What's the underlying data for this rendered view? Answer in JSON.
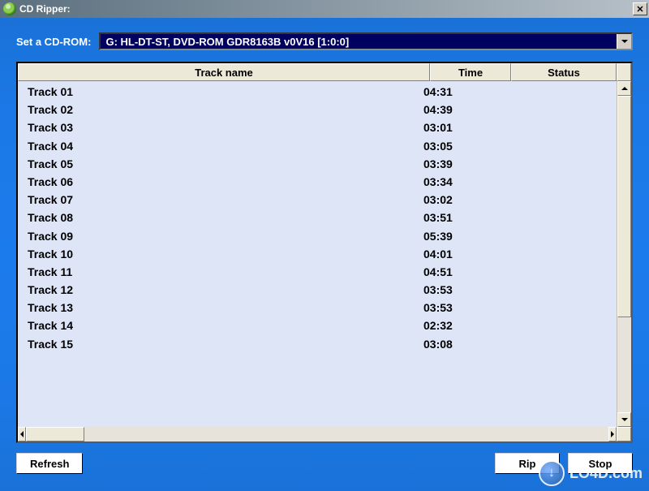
{
  "window": {
    "title": "CD Ripper:"
  },
  "cdrom": {
    "label": "Set a CD-ROM:",
    "selected": "G: HL-DT-ST, DVD-ROM GDR8163B v0V16 [1:0:0]"
  },
  "columns": {
    "trackname": "Track name",
    "time": "Time",
    "status": "Status"
  },
  "tracks": [
    {
      "name": "Track 01",
      "time": "04:31",
      "status": ""
    },
    {
      "name": "Track 02",
      "time": "04:39",
      "status": ""
    },
    {
      "name": "Track 03",
      "time": "03:01",
      "status": ""
    },
    {
      "name": "Track 04",
      "time": "03:05",
      "status": ""
    },
    {
      "name": "Track 05",
      "time": "03:39",
      "status": ""
    },
    {
      "name": "Track 06",
      "time": "03:34",
      "status": ""
    },
    {
      "name": "Track 07",
      "time": "03:02",
      "status": ""
    },
    {
      "name": "Track 08",
      "time": "03:51",
      "status": ""
    },
    {
      "name": "Track 09",
      "time": "05:39",
      "status": ""
    },
    {
      "name": "Track 10",
      "time": "04:01",
      "status": ""
    },
    {
      "name": "Track 11",
      "time": "04:51",
      "status": ""
    },
    {
      "name": "Track 12",
      "time": "03:53",
      "status": ""
    },
    {
      "name": "Track 13",
      "time": "03:53",
      "status": ""
    },
    {
      "name": "Track 14",
      "time": "02:32",
      "status": ""
    },
    {
      "name": "Track 15",
      "time": "03:08",
      "status": ""
    }
  ],
  "buttons": {
    "refresh": "Refresh",
    "rip": "Rip",
    "stop": "Stop"
  },
  "watermark": {
    "symbol": "↓",
    "text": "LO4D.com"
  }
}
